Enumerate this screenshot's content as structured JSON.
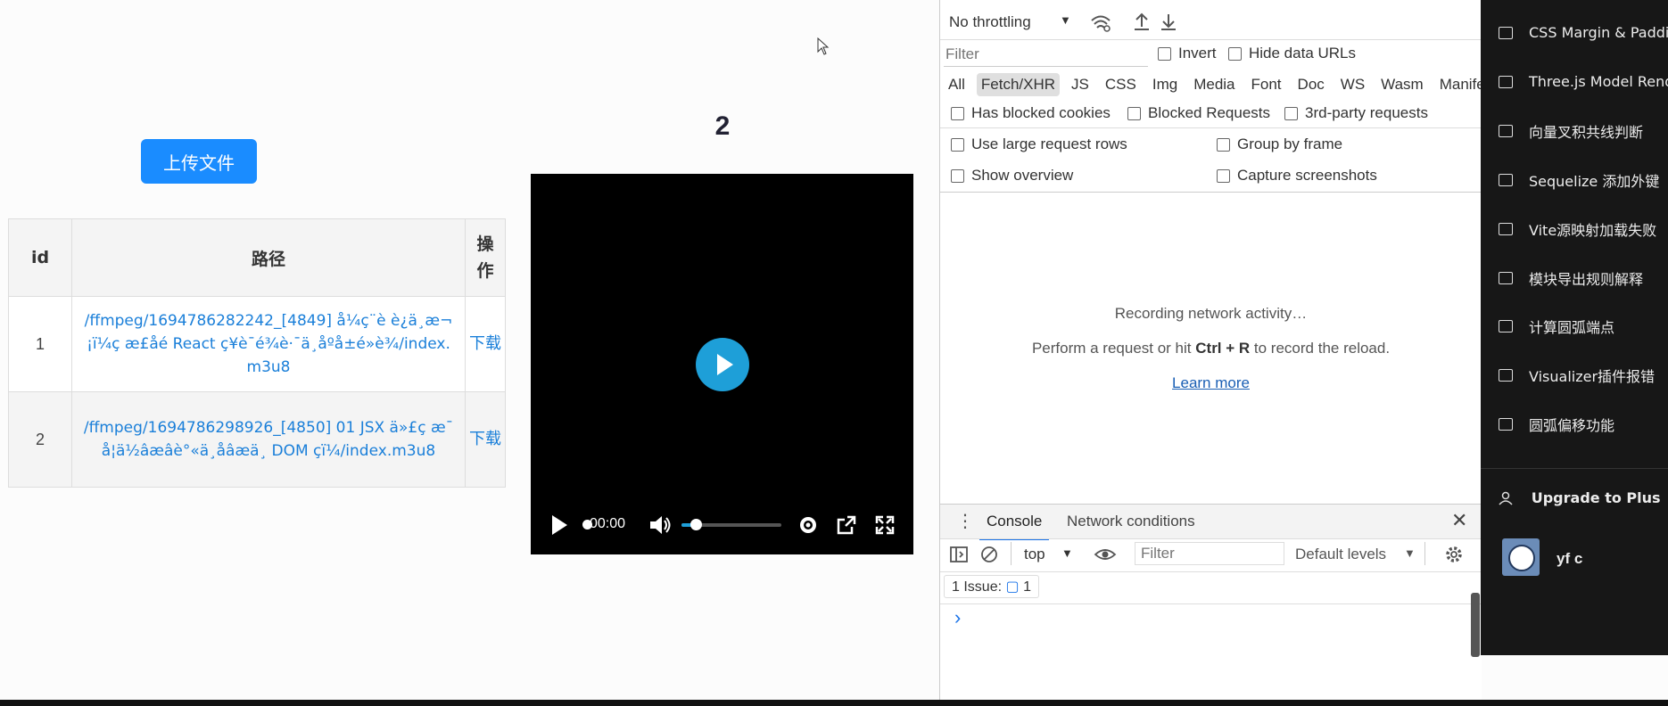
{
  "page": {
    "upload_button": "上传文件",
    "table": {
      "headers": [
        "id",
        "路径",
        "操\n作"
      ],
      "rows": [
        {
          "id": "1",
          "path": "/ffmpeg/1694786282242_[4849] å¼ç¨è è¿ä¸æ¬¡ï¼ç æ£åé React ç¥è¯é¾è·¯ä¸åºå±é»è¾/index.m3u8",
          "op": "下载"
        },
        {
          "id": "2",
          "path": "/ffmpeg/1694786298926_[4850] 01 JSX ä»£ç æ¯å¦ä½âæâè°«ä¸åâæä¸ DOM çï¼/index.m3u8",
          "op": "下载"
        }
      ]
    },
    "video_title": "2",
    "video": {
      "time": "00:00"
    }
  },
  "devtools": {
    "throttling": "No throttling",
    "filter_placeholder": "Filter",
    "invert": "Invert",
    "hide_data_urls": "Hide data URLs",
    "types": [
      "All",
      "Fetch/XHR",
      "JS",
      "CSS",
      "Img",
      "Media",
      "Font",
      "Doc",
      "WS",
      "Wasm",
      "Manifest"
    ],
    "selected_type": "Fetch/XHR",
    "has_blocked_cookies": "Has blocked cookies",
    "blocked_requests": "Blocked Requests",
    "third_party": "3rd-party requests",
    "large_rows": "Use large request rows",
    "group_by_frame": "Group by frame",
    "show_overview": "Show overview",
    "capture_screenshots": "Capture screenshots",
    "recording": "Recording network activity…",
    "perform_pre": "Perform a request or hit ",
    "perform_keys": "Ctrl + R",
    "perform_post": " to record the reload.",
    "learn_more": "Learn more",
    "drawer_tabs": [
      "Console",
      "Network conditions"
    ],
    "context": "top",
    "console_filter_placeholder": "Filter",
    "default_levels": "Default levels",
    "issues_label": "1 Issue:",
    "issues_count": "1",
    "prompt": "›"
  },
  "sidebar": {
    "items": [
      "CSS Margin & Padding",
      "Three.js Model Render",
      "向量叉积共线判断",
      "Sequelize 添加外键",
      "Vite源映射加载失败",
      "模块导出规则解释",
      "计算圆弧端点",
      "Visualizer插件报错",
      "圆弧偏移功能"
    ],
    "upgrade": "Upgrade to Plus",
    "user": "yf c"
  },
  "colors": {
    "accent": "#1a8cff",
    "link": "#1a7fd9",
    "sidebar_bg": "#171717"
  }
}
